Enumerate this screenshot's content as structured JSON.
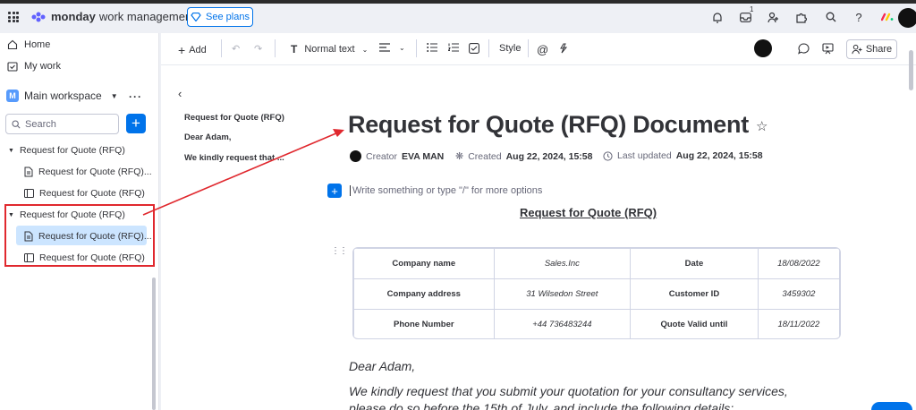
{
  "topbar": {
    "brand": "monday",
    "brand_sub": "work management",
    "see_plans": "See plans",
    "inbox_badge": "1"
  },
  "sidebar": {
    "home": "Home",
    "my_work": "My work",
    "workspace_initial": "M",
    "workspace_name": "Main workspace",
    "search_placeholder": "Search",
    "folders": [
      {
        "label": "Request for Quote (RFQ)",
        "items": [
          "Request for Quote (RFQ)...",
          "Request for Quote (RFQ)"
        ]
      },
      {
        "label": "Request for Quote (RFQ)",
        "items": [
          "Request for Quote (RFQ)...",
          "Request for Quote (RFQ)"
        ]
      }
    ]
  },
  "toolbar": {
    "add": "Add",
    "text_style": "Normal text",
    "style": "Style",
    "share": "Share"
  },
  "toc": [
    "Request for Quote (RFQ)",
    "Dear Adam,",
    "We kindly request that ..."
  ],
  "doc": {
    "title": "Request for Quote (RFQ) Document",
    "creator_label": "Creator",
    "creator": "EVA MAN",
    "created_label": "Created",
    "created": "Aug 22, 2024, 15:58",
    "updated_label": "Last updated",
    "updated": "Aug 22, 2024, 15:58",
    "placeholder": "Write something or type \"/\" for more options",
    "heading": "Request for Quote (RFQ)",
    "table": [
      [
        "Company name",
        "Sales.Inc",
        "Date",
        "18/08/2022"
      ],
      [
        "Company address",
        "31 Wilsedon Street",
        "Customer ID",
        "3459302"
      ],
      [
        "Phone Number",
        "+44 736483244",
        "Quote Valid until",
        "18/11/2022"
      ]
    ],
    "greeting": "Dear Adam,",
    "line1": "We kindly request that you submit your quotation for your consultancy services,",
    "line2": "please do so before the 15th of July, and include the following details:"
  },
  "colors": {
    "accent": "#0073ea",
    "highlight": "#e0282e",
    "selected": "#cce5ff"
  }
}
